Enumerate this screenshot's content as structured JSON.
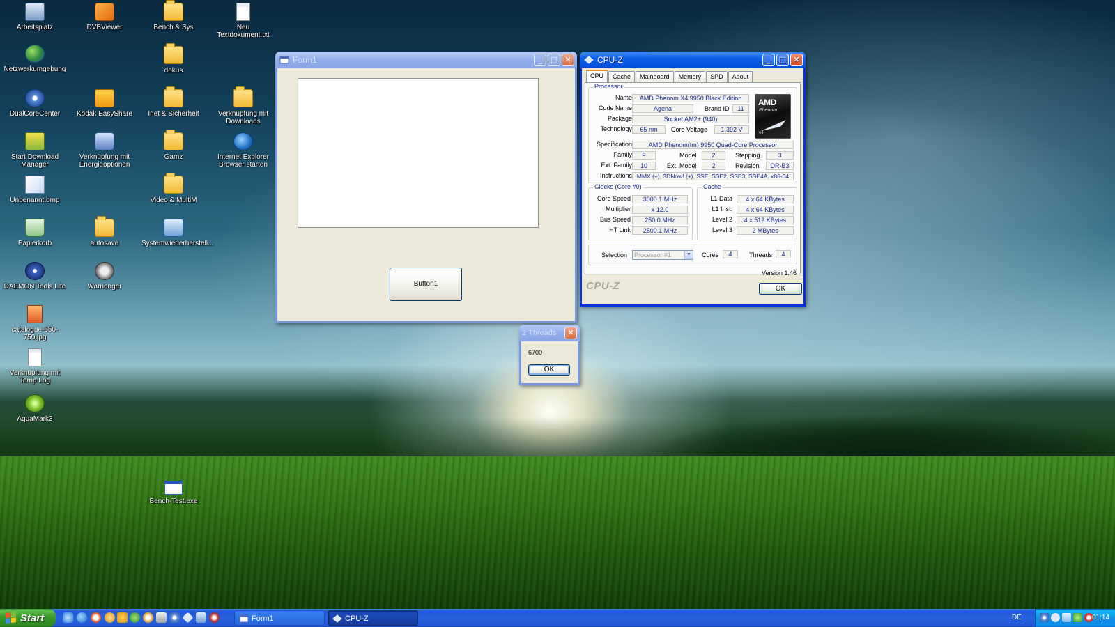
{
  "desktop": {
    "icons": [
      {
        "label": "Arbeitsplatz",
        "icon": "my-computer-icon"
      },
      {
        "label": "DVBViewer",
        "icon": "dvbviewer-icon"
      },
      {
        "label": "Bench & Sys",
        "icon": "folder-icon"
      },
      {
        "label": "Neu Textdokument.txt",
        "icon": "text-document-icon"
      },
      {
        "label": "Netzwerkumgebung",
        "icon": "network-icon"
      },
      {
        "label": "dokus",
        "icon": "folder-icon"
      },
      {
        "label": "DualCoreCenter",
        "icon": "dualcorecenter-icon"
      },
      {
        "label": "Kodak EasyShare",
        "icon": "kodak-icon"
      },
      {
        "label": "Inet & Sicherheit",
        "icon": "folder-icon"
      },
      {
        "label": "Verknüpfung mit Downloads",
        "icon": "folder-shortcut-icon"
      },
      {
        "label": "Start Download Manager",
        "icon": "download-manager-icon"
      },
      {
        "label": "Verknüpfung mit Energieoptionen",
        "icon": "power-options-icon"
      },
      {
        "label": "Gamz",
        "icon": "folder-icon"
      },
      {
        "label": "Internet Explorer Browser starten",
        "icon": "internet-explorer-icon"
      },
      {
        "label": "Unbenannt.bmp",
        "icon": "bitmap-icon"
      },
      {
        "label": "Video & MultiM",
        "icon": "folder-icon"
      },
      {
        "label": "Papierkorb",
        "icon": "recycle-bin-icon"
      },
      {
        "label": "autosave",
        "icon": "folder-icon"
      },
      {
        "label": "Systemwiederherstell...",
        "icon": "system-restore-icon"
      },
      {
        "label": "DAEMON Tools Lite",
        "icon": "daemon-tools-icon"
      },
      {
        "label": "Warnonger",
        "icon": "warnonger-icon"
      },
      {
        "label": "catalogue-650-750.jpg",
        "icon": "jpg-file-icon"
      },
      {
        "label": "Verknüpfung mit Temp Log",
        "icon": "text-shortcut-icon"
      },
      {
        "label": "AquaMark3",
        "icon": "aquamark-icon"
      },
      {
        "label": "Bench-Test.exe",
        "icon": "exe-file-icon"
      }
    ]
  },
  "form1": {
    "title": "Form1",
    "button_label": "Button1"
  },
  "cpuz": {
    "title": "CPU-Z",
    "tabs": [
      "CPU",
      "Cache",
      "Mainboard",
      "Memory",
      "SPD",
      "About"
    ],
    "processor": {
      "group_title": "Processor",
      "name_label": "Name",
      "name": "AMD Phenom X4 9950 Black Edition",
      "codename_label": "Code Name",
      "codename": "Agena",
      "brandid_label": "Brand ID",
      "brandid": "11",
      "package_label": "Package",
      "package": "Socket AM2+ (940)",
      "technology_label": "Technology",
      "technology": "65 nm",
      "corevoltage_label": "Core Voltage",
      "corevoltage": "1.392 V",
      "spec_label": "Specification",
      "spec": "AMD Phenom(tm) 9950 Quad-Core Processor",
      "family_label": "Family",
      "family": "F",
      "model_label": "Model",
      "model": "2",
      "stepping_label": "Stepping",
      "stepping": "3",
      "extfamily_label": "Ext. Family",
      "extfamily": "10",
      "extmodel_label": "Ext. Model",
      "extmodel": "2",
      "revision_label": "Revision",
      "revision": "DR-B3",
      "instructions_label": "Instructions",
      "instructions": "MMX (+), 3DNow! (+), SSE, SSE2, SSE3, SSE4A, x86-64"
    },
    "logo": {
      "brand": "AMD",
      "line": "Phenom",
      "sub": "64"
    },
    "clocks": {
      "group_title": "Clocks (Core #0)",
      "corespeed_label": "Core Speed",
      "corespeed": "3000.1 MHz",
      "multiplier_label": "Multiplier",
      "multiplier": "x 12.0",
      "busspeed_label": "Bus Speed",
      "busspeed": "250.0 MHz",
      "htlink_label": "HT Link",
      "htlink": "2500.1 MHz"
    },
    "cache": {
      "group_title": "Cache",
      "l1data_label": "L1 Data",
      "l1data": "4 x 64 KBytes",
      "l1inst_label": "L1 Inst.",
      "l1inst": "4 x 64 KBytes",
      "level2_label": "Level 2",
      "level2": "4 x 512 KBytes",
      "level3_label": "Level 3",
      "level3": "2 MBytes"
    },
    "selection_label": "Selection",
    "selection_value": "Processor #1",
    "cores_label": "Cores",
    "cores": "4",
    "threads_label": "Threads",
    "threads": "4",
    "version": "Version 1.46",
    "brand_text": "CPU-Z",
    "ok_label": "OK"
  },
  "threads_dialog": {
    "title": "2 Threads",
    "message": "6700",
    "ok_label": "OK"
  },
  "taskbar": {
    "start_label": "Start",
    "tasks": [
      {
        "label": "Form1",
        "active": false
      },
      {
        "label": "CPU-Z",
        "active": true
      }
    ],
    "language": "DE",
    "clock": "01:14"
  },
  "colors": {
    "xp_blue": "#0a5de8",
    "start_green": "#3a9a2c",
    "cpuz_value_text": "#1a2a8c"
  }
}
